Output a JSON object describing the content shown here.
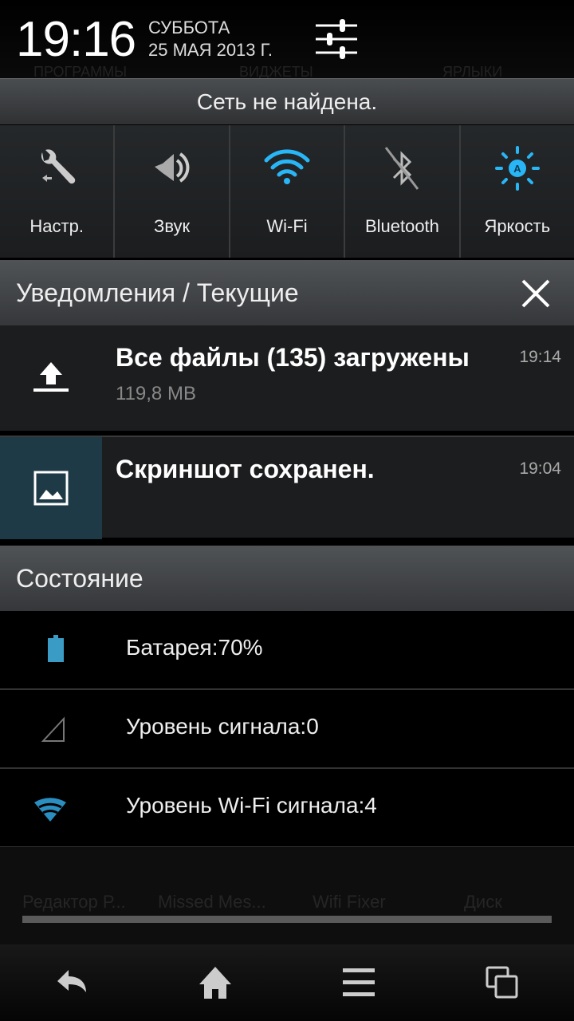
{
  "header": {
    "time": "19:16",
    "weekday": "СУББОТА",
    "date": "25 МАЯ 2013 Г."
  },
  "background": {
    "tabs": [
      "ПРОГРАММЫ",
      "ВИДЖЕТЫ",
      "ЯРЛЫКИ"
    ],
    "apps": [
      "Редактор Р...",
      "Missed Mes...",
      "Wifi Fixer",
      "Диск"
    ]
  },
  "network_status": "Сеть не найдена.",
  "quick_settings": [
    {
      "label": "Настр.",
      "icon": "wrench-icon"
    },
    {
      "label": "Звук",
      "icon": "speaker-icon"
    },
    {
      "label": "Wi-Fi",
      "icon": "wifi-icon"
    },
    {
      "label": "Bluetooth",
      "icon": "bluetooth-off-icon"
    },
    {
      "label": "Яркость",
      "icon": "brightness-auto-icon"
    }
  ],
  "notifications": {
    "title": "Уведомления / Текущие",
    "items": [
      {
        "title": "Все файлы (135) загружены",
        "subtitle": "119,8 MB",
        "time": "19:14",
        "icon": "upload-icon"
      },
      {
        "title": "Скриншот сохранен.",
        "time": "19:04",
        "icon": "image-icon"
      }
    ]
  },
  "status": {
    "title": "Состояние",
    "items": [
      {
        "label": "Батарея:70%",
        "icon": "battery-icon",
        "level": 70
      },
      {
        "label": "Уровень сигнала:0",
        "icon": "signal-icon",
        "level": 0
      },
      {
        "label": "Уровень Wi-Fi сигнала:4",
        "icon": "wifi-icon",
        "level": 4
      }
    ]
  },
  "colors": {
    "accent": "#29b6f6",
    "battery": "#3a9bc4"
  }
}
